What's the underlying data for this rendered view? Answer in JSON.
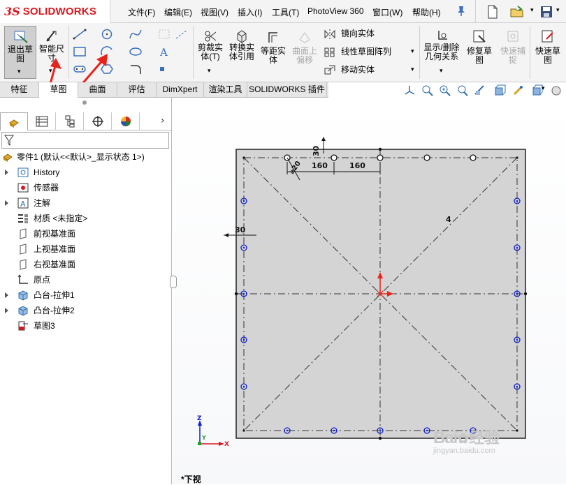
{
  "app": {
    "brand_prefix": "3S",
    "brand_name": "SOLIDWORKS"
  },
  "menus": [
    "文件(F)",
    "编辑(E)",
    "视图(V)",
    "插入(I)",
    "工具(T)",
    "PhotoView 360",
    "窗口(W)",
    "帮助(H)"
  ],
  "ribbon": {
    "exit_sketch": "退出草\n图",
    "smart_dim": "智能尺\n寸",
    "trim": "剪裁实\n体(T)",
    "convert": "转换实\n体引用",
    "offset": "等距实\n体",
    "surface_offset": "曲面上\n偏移",
    "mirror": "镜向实体",
    "linear_pattern": "线性草图阵列",
    "move": "移动实体",
    "display_relations": "显示/删除\n几何关系",
    "repair": "修复草\n图",
    "quick_snap": "快速捕\n捉",
    "rapid_sketch": "快速草\n图"
  },
  "tabs": [
    "特征",
    "草图",
    "曲面",
    "评估",
    "DimXpert",
    "渲染工具",
    "SOLIDWORKS 插件"
  ],
  "active_tab": "草图",
  "tree": {
    "root": "零件1 (默认<<默认>_显示状态 1>)",
    "items": [
      {
        "label": "History",
        "icon": "history-icon",
        "expandable": true
      },
      {
        "label": "传感器",
        "icon": "sensor-icon",
        "expandable": false
      },
      {
        "label": "注解",
        "icon": "annotation-icon",
        "expandable": true
      },
      {
        "label": "材质 <未指定>",
        "icon": "material-icon",
        "expandable": false
      },
      {
        "label": "前视基准面",
        "icon": "plane-icon",
        "expandable": false
      },
      {
        "label": "上视基准面",
        "icon": "plane-icon",
        "expandable": false
      },
      {
        "label": "右视基准面",
        "icon": "plane-icon",
        "expandable": false
      },
      {
        "label": "原点",
        "icon": "origin-icon",
        "expandable": false
      },
      {
        "label": "凸台-拉伸1",
        "icon": "extrude-icon",
        "expandable": true
      },
      {
        "label": "凸台-拉伸2",
        "icon": "extrude-icon",
        "expandable": true
      },
      {
        "label": "草图3",
        "icon": "sketch-icon",
        "expandable": false
      }
    ]
  },
  "drawing": {
    "dims": {
      "top_offset": "30",
      "circle_dia": "⌀20",
      "spacing_1": "160",
      "spacing_2": "160",
      "side_offset": "30",
      "diag_label": "4"
    },
    "view_name": "*下视"
  },
  "triad": {
    "x": "X",
    "y": "Y",
    "z": "Z"
  },
  "watermark": {
    "brand": "Bai",
    "brand2": "经验",
    "url": "jingyan.baidu.com"
  },
  "colors": {
    "brand_red": "#d8181f",
    "sketch_blue": "#1020d0",
    "dim_black": "#000000",
    "annot_red": "#e8231b",
    "part_gray": "#d4d4d4"
  }
}
